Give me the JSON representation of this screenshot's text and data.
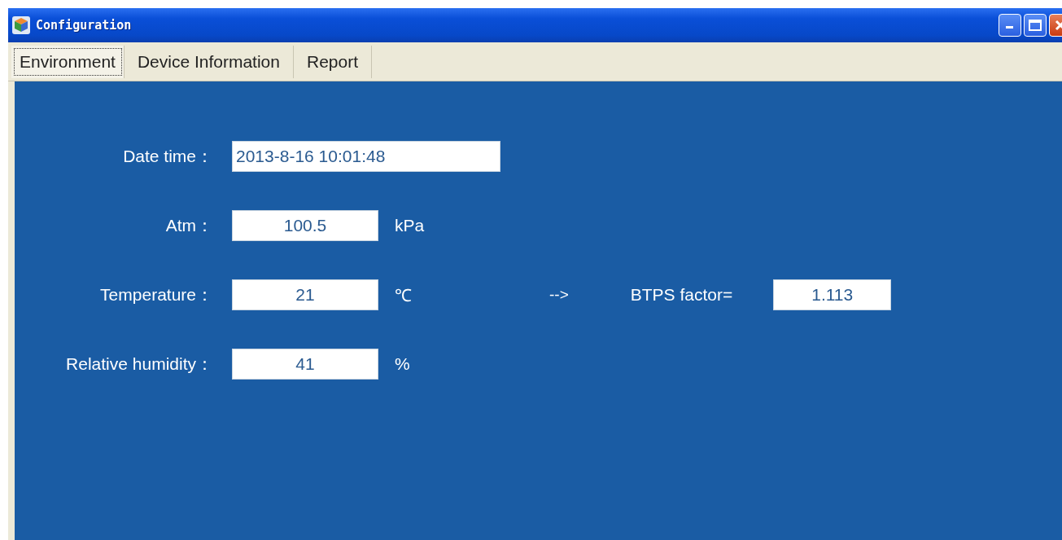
{
  "window": {
    "title": "Configuration"
  },
  "tabs": [
    {
      "label": "Environment",
      "selected": true
    },
    {
      "label": "Device Information",
      "selected": false
    },
    {
      "label": "Report",
      "selected": false
    }
  ],
  "fields": [
    {
      "label": "Date time：",
      "value": "2013-8-16 10:01:48",
      "kind": "wide"
    },
    {
      "label": "Atm：",
      "value": "100.5",
      "unit": "kPa",
      "kind": "narrow"
    },
    {
      "label": "Temperature：",
      "value": "21",
      "unit": "℃",
      "kind": "narrow",
      "result": {
        "arrow": "-->",
        "label": "BTPS factor=",
        "value": "1.113"
      }
    },
    {
      "label": "Relative humidity：",
      "value": "41",
      "unit": "%",
      "kind": "narrow"
    }
  ]
}
